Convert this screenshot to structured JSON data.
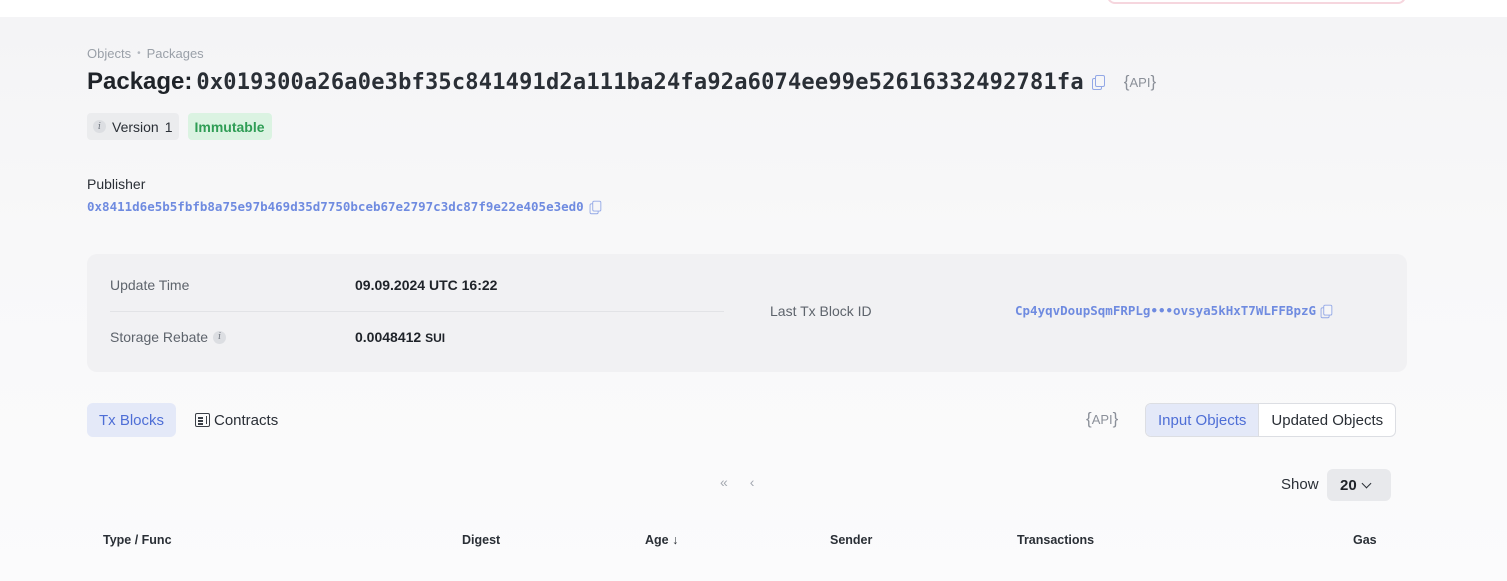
{
  "breadcrumb": {
    "items": [
      "Objects",
      "Packages"
    ],
    "separator": "•"
  },
  "package": {
    "title_label": "Package:",
    "address": "0x019300a26a0e3bf35c841491d2a111ba24fa92a6074ee99e52616332492781fa",
    "api_label": "API"
  },
  "badges": {
    "version_label": "Version",
    "version_value": "1",
    "status": "Immutable"
  },
  "publisher": {
    "label": "Publisher",
    "address": "0x8411d6e5b5fbfb8a75e97b469d35d7750bceb67e2797c3dc87f9e22e405e3ed0"
  },
  "info": {
    "update_time_label": "Update Time",
    "update_time_value": "09.09.2024 UTC 16:22",
    "storage_rebate_label": "Storage Rebate",
    "storage_rebate_value": "0.0048412",
    "storage_rebate_unit": "SUI",
    "last_tx_label": "Last Tx Block ID",
    "last_tx_value": "Cp4yqvDoupSqmFRPLg•••ovsya5kHxT7WLFFBpzG"
  },
  "tabs": {
    "tx_blocks": "Tx Blocks",
    "contracts": "Contracts"
  },
  "api_label_2": "API",
  "segments": {
    "input": "Input Objects",
    "updated": "Updated Objects"
  },
  "pager": {
    "first": "«",
    "prev": "‹"
  },
  "show": {
    "label": "Show",
    "value": "20"
  },
  "table": {
    "headers": [
      "Type / Func",
      "Digest",
      "Age ↓",
      "Sender",
      "Transactions",
      "Gas"
    ]
  },
  "colors": {
    "accent": "#4e6ed6",
    "link": "#6f8be0",
    "success": "#2f9d55",
    "success_bg": "#dbf3e2"
  }
}
